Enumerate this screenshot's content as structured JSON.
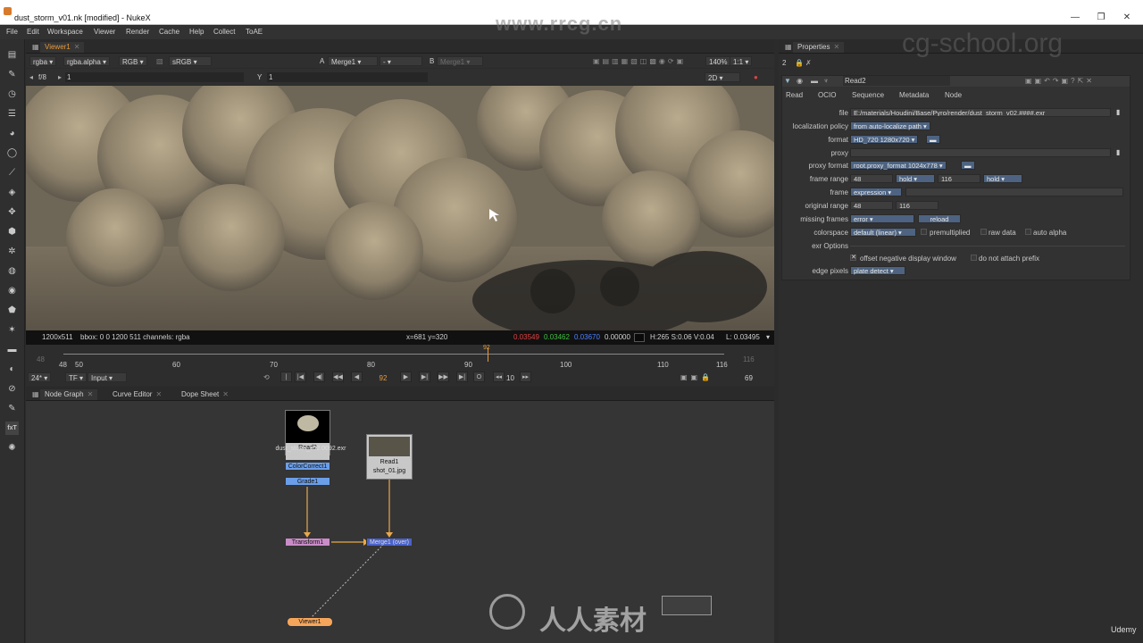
{
  "window": {
    "title": "dust_storm_v01.nk [modified] - NukeX"
  },
  "menu": [
    "File",
    "Edit",
    "Workspace",
    "Viewer",
    "Render",
    "Cache",
    "Help",
    "Collect",
    "ToAE"
  ],
  "viewer": {
    "tab": "Viewer1",
    "channels": "rgba",
    "alpha": "rgba.alpha",
    "rgb": "RGB",
    "colorspace": "sRGB",
    "a_label": "A",
    "a_input": "Merge1",
    "a_dash": "-",
    "b_label": "B",
    "b_input": "Merge1",
    "zoom": "140%",
    "ratio": "1:1",
    "fstop": "f/8",
    "frame_val": "1",
    "y_label": "Y",
    "y_val": "1",
    "mode": "2D",
    "info": {
      "res": "1200x511",
      "bbox": "bbox: 0 0 1200 511 channels: rgba",
      "coords": "x=681 y=320",
      "r": "0.03549",
      "g": "0.03462",
      "b": "0.03670",
      "a": "0.00000",
      "hsv": "H:265 S:0.06 V:0.04",
      "l": "L: 0.03495"
    },
    "timeline": {
      "start_dim": "48",
      "end_dim": "116",
      "ticks": [
        "48",
        "50",
        "60",
        "70",
        "80",
        "90",
        "100",
        "110",
        "116"
      ],
      "current": "92"
    },
    "transport": {
      "fps": "24*",
      "tf": "TF",
      "input": "Input",
      "frame": "92",
      "step": "10",
      "end": "69"
    }
  },
  "nodegraph": {
    "tabs": [
      "Node Graph",
      "Curve Editor",
      "Dope Sheet"
    ],
    "nodes": {
      "read2": "Read2",
      "read2_file": "dust_storm_v02.0092.exr",
      "cc": "ColorCorrect1",
      "grade": "Grade1",
      "read1": "Read1",
      "read1_file": "shot_01.jpg",
      "transform": "Transform1",
      "merge": "Merge1 (over)",
      "viewer": "Viewer1"
    }
  },
  "properties": {
    "tab": "Properties",
    "count": "2",
    "node_name": "Read2",
    "tabs": [
      "Read",
      "OCIO",
      "Sequence",
      "Metadata",
      "Node"
    ],
    "file_label": "file",
    "file": "E:/materials/Houdini/Base/Pyro/render/dust_storm_v02.####.exr",
    "loc_label": "localization policy",
    "loc": "from auto-localize path",
    "format_label": "format",
    "format": "HD_720 1280x720",
    "proxy_label": "proxy",
    "proxyfmt_label": "proxy format",
    "proxyfmt": "root.proxy_format 1024x778",
    "range_label": "frame range",
    "range_start": "48",
    "hold1": "hold",
    "range_end": "116",
    "hold2": "hold",
    "frame_label": "frame",
    "frame": "expression",
    "orig_label": "original range",
    "orig_start": "48",
    "orig_end": "116",
    "missing_label": "missing frames",
    "missing": "error",
    "reload": "reload",
    "cs_label": "colorspace",
    "cs": "default (linear)",
    "premult": "premultiplied",
    "raw": "raw data",
    "autoalpha": "auto alpha",
    "exr_label": "exr Options",
    "offset": "offset negative display window",
    "noattach": "do not attach prefix",
    "edge_label": "edge pixels",
    "edge": "plate detect"
  },
  "watermarks": {
    "rrcg": "www.rrcg.cn",
    "cgschool": "cg-school.org",
    "rrsc": "人人素材",
    "udemy": "Udemy"
  }
}
